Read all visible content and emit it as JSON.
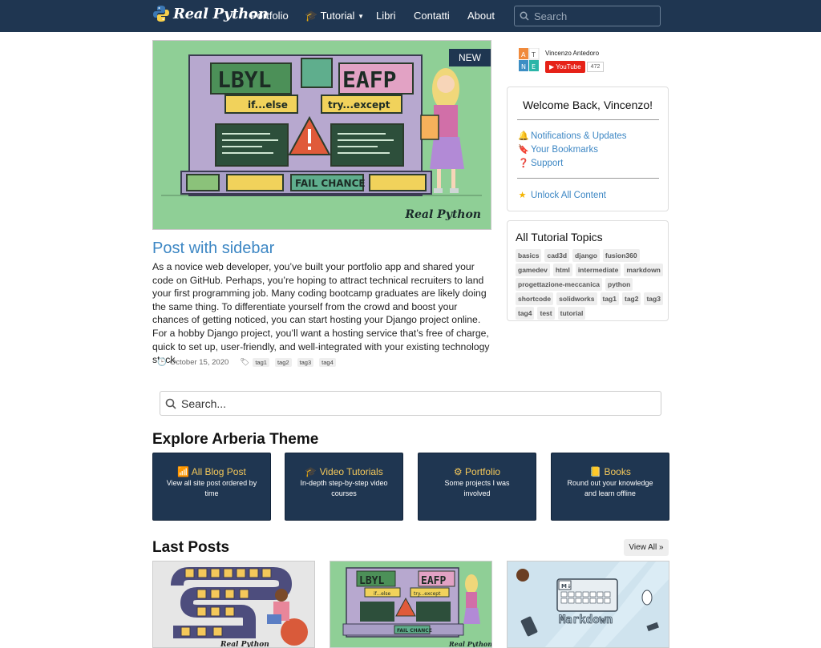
{
  "nav": {
    "brand": "Real Python",
    "links": [
      "Portfolio",
      "Tutorial",
      "Libri",
      "Contatti",
      "About"
    ],
    "search_placeholder": "Search"
  },
  "hero": {
    "badge": "NEW",
    "image_text": {
      "left": "LBYL",
      "right": "EAFP",
      "if": "if...else",
      "try": "try...except",
      "fail": "FAIL CHANCE",
      "signature": "Real Python"
    }
  },
  "post": {
    "title": "Post with sidebar",
    "excerpt": "As a novice web developer, you’ve built your portfolio app and shared your code on GitHub. Perhaps, you’re hoping to attract technical recruiters to land your first programming job. Many coding bootcamp graduates are likely doing the same thing. To differentiate yourself from the crowd and boost your chances of getting noticed, you can start hosting your Django project online. For a hobby Django project, you’ll want a hosting service that’s free of charge, quick to set up, user-friendly, and well-integrated with your existing technology stack.",
    "date": "October 15, 2020",
    "tags": [
      "tag1",
      "tag2",
      "tag3",
      "tag4"
    ]
  },
  "author": {
    "name": "Vincenzo Antedoro",
    "avatar_letters": [
      "A",
      "T",
      "N",
      "E"
    ],
    "youtube_label": "YouTube",
    "subscriber_count": "472"
  },
  "welcome": {
    "title": "Welcome Back, Vincenzo!",
    "links": [
      "Notifications & Updates",
      "Your Bookmarks",
      "Support"
    ],
    "unlock": "Unlock All Content"
  },
  "topics": {
    "title": "All Tutorial Topics",
    "tags": [
      "basics",
      "cad3d",
      "django",
      "fusion360",
      "gamedev",
      "html",
      "intermediate",
      "markdown",
      "progettazione-meccanica",
      "python",
      "shortcode",
      "solidworks",
      "tag1",
      "tag2",
      "tag3",
      "tag4",
      "test",
      "tutorial"
    ]
  },
  "search": {
    "placeholder": "Search..."
  },
  "explore": {
    "heading": "Explore Arberia Theme",
    "cards": [
      {
        "title": "All Blog Post",
        "desc": "View all site post ordered by time",
        "icon": "rss-icon"
      },
      {
        "title": "Video Tutorials",
        "desc": "In-depth step-by-step video courses",
        "icon": "graduation-cap-icon"
      },
      {
        "title": "Portfolio",
        "desc": "Some projects I was involved",
        "icon": "project-diagram-icon"
      },
      {
        "title": "Books",
        "desc": "Round out your knowledge and learn offline",
        "icon": "book-icon"
      }
    ]
  },
  "last_posts": {
    "heading": "Last Posts",
    "view_all": "View All »",
    "thumb_texts": {
      "first_signature": "Real Python",
      "second_left": "LBYL",
      "second_right": "EAFP",
      "second_if": "if...else",
      "second_try": "try...except",
      "second_fail": "FAIL CHANCE",
      "second_signature": "Real Python",
      "third_badge": "M↓",
      "third_word": "Markdown"
    }
  },
  "colors": {
    "navbar": "#1f3651",
    "link": "#3d87c4",
    "accent": "#f4c85a",
    "hero_bg": "#8fcf96"
  }
}
